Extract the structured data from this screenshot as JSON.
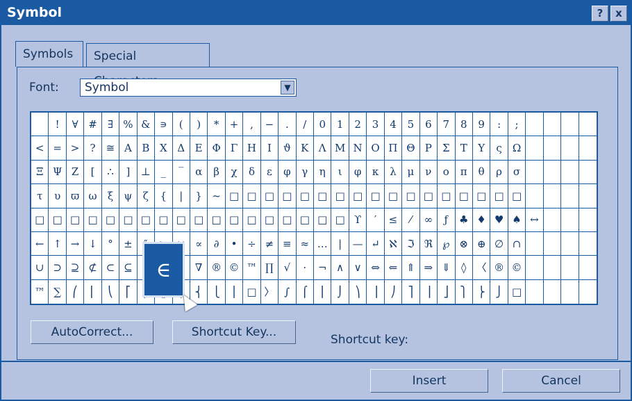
{
  "window": {
    "title": "Symbol"
  },
  "titlebar_buttons": {
    "help": "?",
    "close": "x"
  },
  "tabs": [
    {
      "label": "Symbols"
    },
    {
      "label": "Special Characters"
    }
  ],
  "font": {
    "label": "Font:",
    "value": "Symbol"
  },
  "grid": {
    "rows": [
      [
        " ",
        "!",
        "∀",
        "#",
        "∃",
        "%",
        "&",
        "∍",
        "(",
        ")",
        "*",
        "+",
        ",",
        "−",
        ".",
        "/",
        "0",
        "1",
        "2",
        "3",
        "4",
        "5",
        "6",
        "7",
        "8",
        "9",
        ":",
        ";"
      ],
      [
        "<",
        "=",
        ">",
        "?",
        "≅",
        "Α",
        "Β",
        "Χ",
        "Δ",
        "Ε",
        "Φ",
        "Γ",
        "Η",
        "Ι",
        "ϑ",
        "Κ",
        "Λ",
        "Μ",
        "Ν",
        "Ο",
        "Π",
        "Θ",
        "Ρ",
        "Σ",
        "Τ",
        "Υ",
        "ς",
        "Ω"
      ],
      [
        "Ξ",
        "Ψ",
        "Ζ",
        "[",
        "∴",
        "]",
        "⊥",
        "_",
        "‾",
        "α",
        "β",
        "χ",
        "δ",
        "ε",
        "φ",
        "γ",
        "η",
        "ι",
        "φ",
        "κ",
        "λ",
        "μ",
        "ν",
        "ο",
        "π",
        "θ",
        "ρ",
        "σ"
      ],
      [
        "τ",
        "υ",
        "ϖ",
        "ω",
        "ξ",
        "ψ",
        "ζ",
        "{",
        "|",
        "}",
        "~",
        "□",
        "□",
        "□",
        "□",
        "□",
        "□",
        "□",
        "□",
        "□",
        "□",
        "□",
        "□",
        "□",
        "□",
        "□",
        "□",
        "□"
      ],
      [
        "□",
        "□",
        "□",
        "□",
        "□",
        "□",
        "□",
        "□",
        "□",
        "□",
        "□",
        "□",
        "□",
        "□",
        "□",
        "□",
        "□",
        "□",
        "ϒ",
        "′",
        "≤",
        "⁄",
        "∞",
        "ƒ",
        "♣",
        "♦",
        "♥",
        "♠",
        "↔"
      ],
      [
        "←",
        "↑",
        "→",
        "↓",
        "°",
        "±",
        "″",
        "≥",
        "×",
        "∝",
        "∂",
        "•",
        "÷",
        "≠",
        "≡",
        "≈",
        "…",
        "|",
        "—",
        "↵",
        "ℵ",
        "ℑ",
        "ℜ",
        "℘",
        "⊗",
        "⊕",
        "∅",
        "∩"
      ],
      [
        "∪",
        "⊃",
        "⊇",
        "⊄",
        "⊂",
        "⊆",
        "∈",
        "∉",
        "∠",
        "∇",
        "®",
        "©",
        "™",
        "∏",
        "√",
        "·",
        "¬",
        "∧",
        "∨",
        "⇔",
        "⇐",
        "⇑",
        "⇒",
        "⇓",
        "◊",
        "〈",
        "®",
        "©"
      ],
      [
        "™",
        "∑",
        "⎛",
        "⎜",
        "⎝",
        "⎡",
        "⎢",
        "⎣",
        "⎧",
        "⎨",
        "⎩",
        "⎪",
        "□",
        "〉",
        "∫",
        "⌠",
        "⎮",
        "⌡",
        "⎞",
        "⎟",
        "⎠",
        "⎤",
        "⎥",
        "⎦",
        "⎫",
        "⎬",
        "⎭",
        "□"
      ]
    ],
    "selected_symbol": "∈"
  },
  "buttons": {
    "autocorrect": "AutoCorrect...",
    "shortcut_key": "Shortcut Key...",
    "insert": "Insert",
    "cancel": "Cancel"
  },
  "shortcut_key_label": "Shortcut key:",
  "colors": {
    "titlebar": "#1a5aa2",
    "dialog_bg": "#b5c3e1",
    "grid_line": "#1a5aa2"
  }
}
